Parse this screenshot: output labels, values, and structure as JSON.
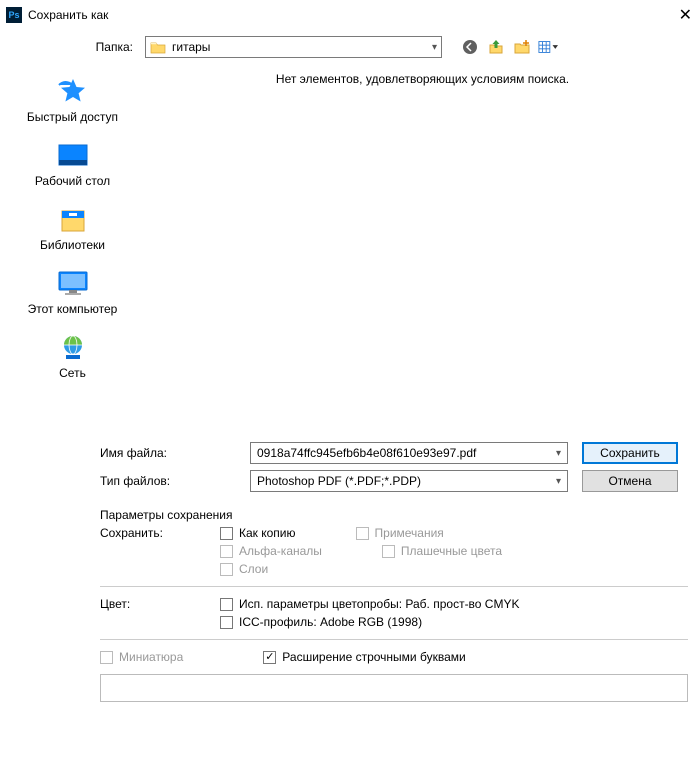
{
  "window": {
    "title": "Сохранить как"
  },
  "folder": {
    "label": "Папка:",
    "value": "гитары"
  },
  "places": {
    "quick_access": "Быстрый доступ",
    "desktop": "Рабочий стол",
    "libraries": "Библиотеки",
    "this_pc": "Этот компьютер",
    "network": "Сеть"
  },
  "filelist": {
    "empty_message": "Нет элементов, удовлетворяющих условиям поиска."
  },
  "fields": {
    "filename_label": "Имя файла:",
    "filename_value": "0918a74ffc945efb6b4e08f610e93e97.pdf",
    "filetype_label": "Тип файлов:",
    "filetype_value": "Photoshop PDF (*.PDF;*.PDP)"
  },
  "buttons": {
    "save": "Сохранить",
    "cancel": "Отмена"
  },
  "options": {
    "title": "Параметры сохранения",
    "save_label": "Сохранить:",
    "as_copy": "Как копию",
    "notes": "Примечания",
    "alpha": "Альфа-каналы",
    "spot": "Плашечные цвета",
    "layers": "Слои",
    "color_label": "Цвет:",
    "proof": "Исп. параметры цветопробы:  Раб. прост-во CMYK",
    "icc": "ICC-профиль:  Adobe RGB (1998)",
    "thumb": "Миниатюра",
    "lowercase_ext": "Расширение строчными буквами"
  }
}
